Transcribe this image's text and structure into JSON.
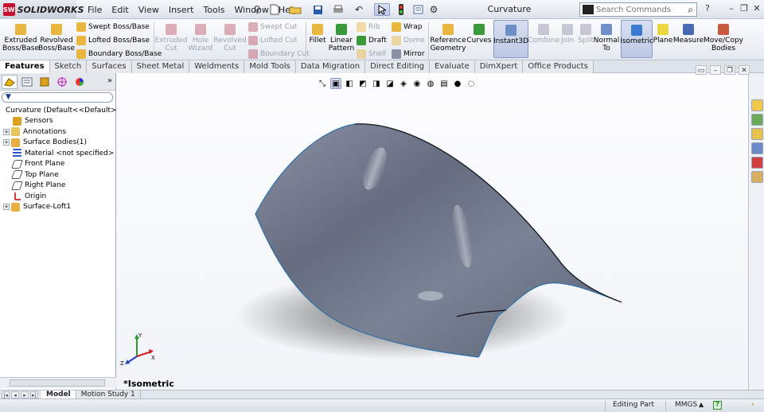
{
  "app": {
    "brand": "SOLIDWORKS",
    "brand_badge": "SW",
    "doc_title": "Curvature"
  },
  "menu": [
    "File",
    "Edit",
    "View",
    "Insert",
    "Tools",
    "Window",
    "Help"
  ],
  "search": {
    "placeholder": "Search Commands"
  },
  "ribbon": {
    "extruded_boss": "Extruded Boss/Base",
    "revolved_boss": "Revolved Boss/Base",
    "swept_boss": "Swept Boss/Base",
    "lofted_boss": "Lofted Boss/Base",
    "boundary_boss": "Boundary Boss/Base",
    "extruded_cut": "Extruded Cut",
    "hole_wizard": "Hole Wizard",
    "revolved_cut": "Revolved Cut",
    "swept_cut": "Swept Cut",
    "lofted_cut": "Lofted Cut",
    "boundary_cut": "Boundary Cut",
    "fillet": "Fillet",
    "linear_pattern": "Linear Pattern",
    "rib": "Rib",
    "draft": "Draft",
    "shell": "Shell",
    "wrap": "Wrap",
    "dome": "Dome",
    "mirror": "Mirror",
    "reference_geometry": "Reference Geometry",
    "curves": "Curves",
    "instant3d": "Instant3D",
    "combine": "Combine",
    "join": "Join",
    "split": "Split",
    "normal_to": "Normal To",
    "isometric": "Isometric",
    "plane": "Plane",
    "measure": "Measure",
    "move_copy": "Move/Copy Bodies"
  },
  "tabs": [
    "Features",
    "Sketch",
    "Surfaces",
    "Sheet Metal",
    "Weldments",
    "Mold Tools",
    "Data Migration",
    "Direct Editing",
    "Evaluate",
    "DimXpert",
    "Office Products"
  ],
  "tree": {
    "root": "Curvature  (Default<<Default>_Di",
    "items": [
      "Sensors",
      "Annotations",
      "Surface Bodies(1)",
      "Material <not specified>",
      "Front Plane",
      "Top Plane",
      "Right Plane",
      "Origin",
      "Surface-Loft1"
    ]
  },
  "viewport": {
    "view_name": "*Isometric",
    "triad": {
      "x": "X",
      "y": "Y",
      "z": "Z"
    }
  },
  "bottom_tabs": [
    "Model",
    "Motion Study 1"
  ],
  "status": {
    "mode": "Editing Part",
    "units": "MMGS",
    "help": "?"
  },
  "colors": {
    "surface": "#6d7487",
    "edge": "#2e6fa8",
    "accent_red": "#c8102e",
    "selected": "#bcc8e6"
  }
}
